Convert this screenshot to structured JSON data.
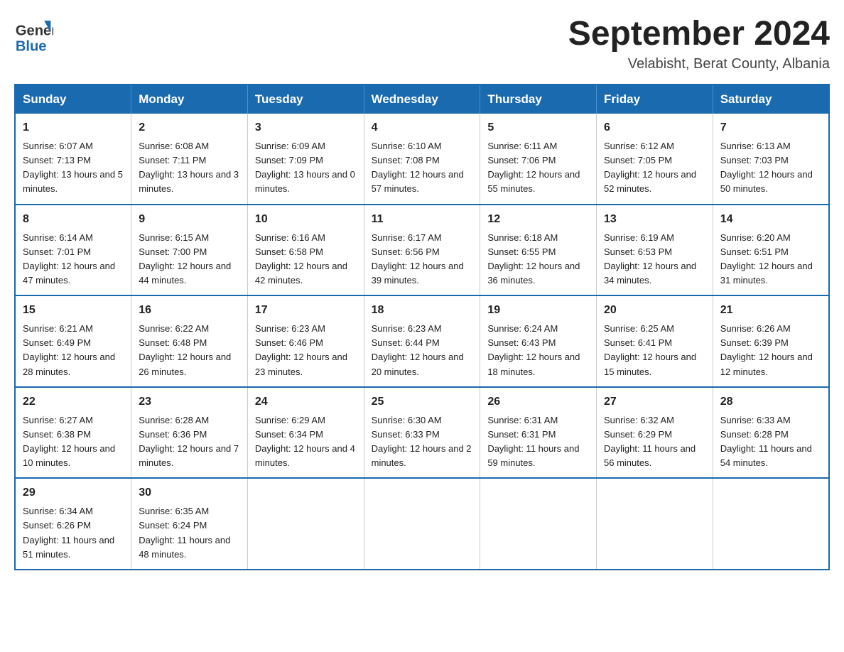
{
  "header": {
    "logo_general": "General",
    "logo_blue": "Blue",
    "month_year": "September 2024",
    "location": "Velabisht, Berat County, Albania"
  },
  "weekdays": [
    "Sunday",
    "Monday",
    "Tuesday",
    "Wednesday",
    "Thursday",
    "Friday",
    "Saturday"
  ],
  "weeks": [
    [
      {
        "day": "1",
        "sunrise": "Sunrise: 6:07 AM",
        "sunset": "Sunset: 7:13 PM",
        "daylight": "Daylight: 13 hours and 5 minutes."
      },
      {
        "day": "2",
        "sunrise": "Sunrise: 6:08 AM",
        "sunset": "Sunset: 7:11 PM",
        "daylight": "Daylight: 13 hours and 3 minutes."
      },
      {
        "day": "3",
        "sunrise": "Sunrise: 6:09 AM",
        "sunset": "Sunset: 7:09 PM",
        "daylight": "Daylight: 13 hours and 0 minutes."
      },
      {
        "day": "4",
        "sunrise": "Sunrise: 6:10 AM",
        "sunset": "Sunset: 7:08 PM",
        "daylight": "Daylight: 12 hours and 57 minutes."
      },
      {
        "day": "5",
        "sunrise": "Sunrise: 6:11 AM",
        "sunset": "Sunset: 7:06 PM",
        "daylight": "Daylight: 12 hours and 55 minutes."
      },
      {
        "day": "6",
        "sunrise": "Sunrise: 6:12 AM",
        "sunset": "Sunset: 7:05 PM",
        "daylight": "Daylight: 12 hours and 52 minutes."
      },
      {
        "day": "7",
        "sunrise": "Sunrise: 6:13 AM",
        "sunset": "Sunset: 7:03 PM",
        "daylight": "Daylight: 12 hours and 50 minutes."
      }
    ],
    [
      {
        "day": "8",
        "sunrise": "Sunrise: 6:14 AM",
        "sunset": "Sunset: 7:01 PM",
        "daylight": "Daylight: 12 hours and 47 minutes."
      },
      {
        "day": "9",
        "sunrise": "Sunrise: 6:15 AM",
        "sunset": "Sunset: 7:00 PM",
        "daylight": "Daylight: 12 hours and 44 minutes."
      },
      {
        "day": "10",
        "sunrise": "Sunrise: 6:16 AM",
        "sunset": "Sunset: 6:58 PM",
        "daylight": "Daylight: 12 hours and 42 minutes."
      },
      {
        "day": "11",
        "sunrise": "Sunrise: 6:17 AM",
        "sunset": "Sunset: 6:56 PM",
        "daylight": "Daylight: 12 hours and 39 minutes."
      },
      {
        "day": "12",
        "sunrise": "Sunrise: 6:18 AM",
        "sunset": "Sunset: 6:55 PM",
        "daylight": "Daylight: 12 hours and 36 minutes."
      },
      {
        "day": "13",
        "sunrise": "Sunrise: 6:19 AM",
        "sunset": "Sunset: 6:53 PM",
        "daylight": "Daylight: 12 hours and 34 minutes."
      },
      {
        "day": "14",
        "sunrise": "Sunrise: 6:20 AM",
        "sunset": "Sunset: 6:51 PM",
        "daylight": "Daylight: 12 hours and 31 minutes."
      }
    ],
    [
      {
        "day": "15",
        "sunrise": "Sunrise: 6:21 AM",
        "sunset": "Sunset: 6:49 PM",
        "daylight": "Daylight: 12 hours and 28 minutes."
      },
      {
        "day": "16",
        "sunrise": "Sunrise: 6:22 AM",
        "sunset": "Sunset: 6:48 PM",
        "daylight": "Daylight: 12 hours and 26 minutes."
      },
      {
        "day": "17",
        "sunrise": "Sunrise: 6:23 AM",
        "sunset": "Sunset: 6:46 PM",
        "daylight": "Daylight: 12 hours and 23 minutes."
      },
      {
        "day": "18",
        "sunrise": "Sunrise: 6:23 AM",
        "sunset": "Sunset: 6:44 PM",
        "daylight": "Daylight: 12 hours and 20 minutes."
      },
      {
        "day": "19",
        "sunrise": "Sunrise: 6:24 AM",
        "sunset": "Sunset: 6:43 PM",
        "daylight": "Daylight: 12 hours and 18 minutes."
      },
      {
        "day": "20",
        "sunrise": "Sunrise: 6:25 AM",
        "sunset": "Sunset: 6:41 PM",
        "daylight": "Daylight: 12 hours and 15 minutes."
      },
      {
        "day": "21",
        "sunrise": "Sunrise: 6:26 AM",
        "sunset": "Sunset: 6:39 PM",
        "daylight": "Daylight: 12 hours and 12 minutes."
      }
    ],
    [
      {
        "day": "22",
        "sunrise": "Sunrise: 6:27 AM",
        "sunset": "Sunset: 6:38 PM",
        "daylight": "Daylight: 12 hours and 10 minutes."
      },
      {
        "day": "23",
        "sunrise": "Sunrise: 6:28 AM",
        "sunset": "Sunset: 6:36 PM",
        "daylight": "Daylight: 12 hours and 7 minutes."
      },
      {
        "day": "24",
        "sunrise": "Sunrise: 6:29 AM",
        "sunset": "Sunset: 6:34 PM",
        "daylight": "Daylight: 12 hours and 4 minutes."
      },
      {
        "day": "25",
        "sunrise": "Sunrise: 6:30 AM",
        "sunset": "Sunset: 6:33 PM",
        "daylight": "Daylight: 12 hours and 2 minutes."
      },
      {
        "day": "26",
        "sunrise": "Sunrise: 6:31 AM",
        "sunset": "Sunset: 6:31 PM",
        "daylight": "Daylight: 11 hours and 59 minutes."
      },
      {
        "day": "27",
        "sunrise": "Sunrise: 6:32 AM",
        "sunset": "Sunset: 6:29 PM",
        "daylight": "Daylight: 11 hours and 56 minutes."
      },
      {
        "day": "28",
        "sunrise": "Sunrise: 6:33 AM",
        "sunset": "Sunset: 6:28 PM",
        "daylight": "Daylight: 11 hours and 54 minutes."
      }
    ],
    [
      {
        "day": "29",
        "sunrise": "Sunrise: 6:34 AM",
        "sunset": "Sunset: 6:26 PM",
        "daylight": "Daylight: 11 hours and 51 minutes."
      },
      {
        "day": "30",
        "sunrise": "Sunrise: 6:35 AM",
        "sunset": "Sunset: 6:24 PM",
        "daylight": "Daylight: 11 hours and 48 minutes."
      },
      null,
      null,
      null,
      null,
      null
    ]
  ]
}
